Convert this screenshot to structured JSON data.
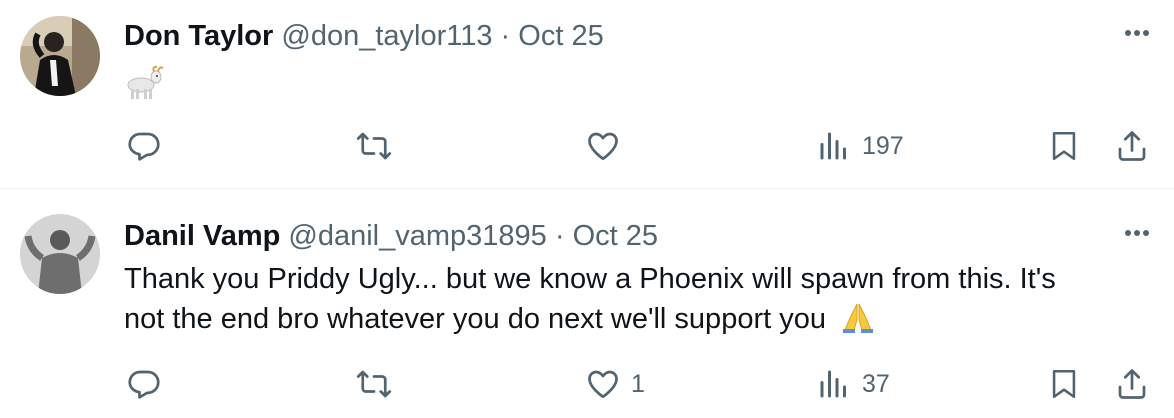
{
  "tweets": [
    {
      "author": "Don Taylor",
      "handle": "@don_taylor113",
      "separator": "·",
      "date": "Oct 25",
      "text_lines": [],
      "body_emoji": "goat-emoji",
      "stats": {
        "replies": "",
        "reposts": "",
        "likes": "",
        "views": "197"
      }
    },
    {
      "author": "Danil Vamp",
      "handle": "@danil_vamp31895",
      "separator": "·",
      "date": "Oct 25",
      "text_lines": [
        "Thank you Priddy Ugly... but we know a Phoenix will spawn from this. It's",
        "not the end bro whatever you do next we'll support you"
      ],
      "trailing_emoji": "folded-hands-emoji",
      "stats": {
        "replies": "",
        "reposts": "",
        "likes": "1",
        "views": "37"
      }
    }
  ],
  "icons": [
    "reply-icon",
    "repost-icon",
    "like-icon",
    "views-icon",
    "bookmark-icon",
    "share-icon",
    "more-icon"
  ],
  "colors": {
    "text": "#0f1419",
    "secondary": "#536471",
    "divider": "#eff3f4",
    "emoji_yellow": "#f8c93f"
  }
}
